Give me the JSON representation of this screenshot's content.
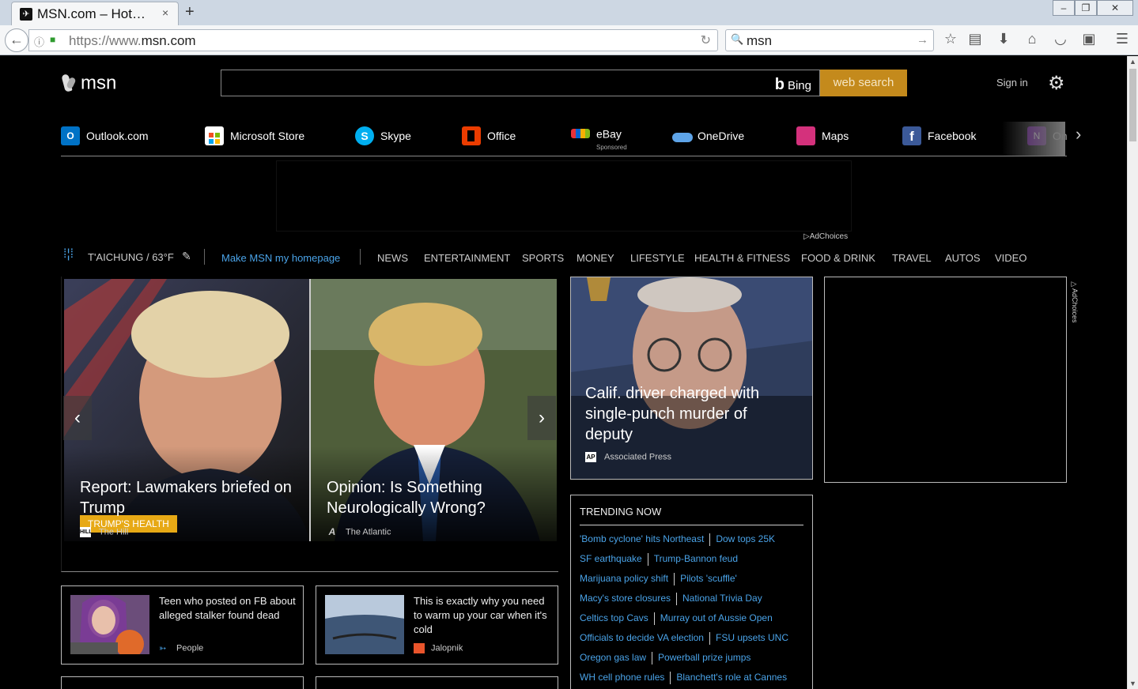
{
  "browser": {
    "tab_title": "MSN.com – Hot…",
    "tab_close": "×",
    "new_tab": "+",
    "url_prefix": "https://www.",
    "url_domain": "msn.com",
    "search_value": "msn",
    "window_controls": [
      "minimize",
      "restore",
      "close"
    ]
  },
  "header": {
    "logo_text": "msn",
    "search_placeholder": "",
    "bing_b": "b",
    "bing_label": "Bing",
    "websearch_label": "web search",
    "signin_label": "Sign in"
  },
  "quicklinks": [
    {
      "label": "Outlook.com",
      "icon": "outlook-icon",
      "color": "#0072c6"
    },
    {
      "label": "Microsoft Store",
      "icon": "store-icon",
      "color": "#ffffff"
    },
    {
      "label": "Skype",
      "icon": "skype-icon",
      "color": "#00aff0"
    },
    {
      "label": "Office",
      "icon": "office-icon",
      "color": "#eb3c00"
    },
    {
      "label": "eBay",
      "sub": "Sponsored",
      "icon": "ebay-icon",
      "color": "#e53238"
    },
    {
      "label": "OneDrive",
      "icon": "onedrive-icon",
      "color": "#5ea4e8"
    },
    {
      "label": "Maps",
      "icon": "maps-icon",
      "color": "#d4317c"
    },
    {
      "label": "Facebook",
      "icon": "facebook-icon",
      "color": "#3b5998"
    },
    {
      "label": "On",
      "icon": "onenote-icon",
      "color": "#7719aa"
    }
  ],
  "ad": {
    "adchoices": "AdChoices"
  },
  "nav": {
    "weather": "T'AICHUNG / 63°F",
    "homepage": "Make MSN my homepage",
    "links": [
      "NEWS",
      "ENTERTAINMENT",
      "SPORTS",
      "MONEY",
      "LIFESTYLE",
      "HEALTH & FITNESS",
      "FOOD & DRINK",
      "TRAVEL",
      "AUTOS",
      "VIDEO"
    ]
  },
  "hero": {
    "tag": "TRUMP'S HEALTH",
    "slides": [
      {
        "title": "Report: Lawmakers briefed on Trump",
        "source": "The Hill",
        "source_logo": "HILL"
      },
      {
        "title": "Opinion: Is Something Neurologically Wrong?",
        "source": "The Atlantic",
        "source_logo": "A"
      }
    ]
  },
  "story": {
    "title": "Calif. driver charged with single-punch murder of deputy",
    "source": "Associated Press",
    "source_logo": "AP"
  },
  "trending": {
    "heading": "TRENDING NOW",
    "rows": [
      [
        "'Bomb cyclone' hits Northeast",
        "Dow tops 25K"
      ],
      [
        "SF earthquake",
        "Trump-Bannon feud"
      ],
      [
        "Marijuana policy shift",
        "Pilots 'scuffle'"
      ],
      [
        "Macy's store closures",
        "National Trivia Day"
      ],
      [
        "Celtics top Cavs",
        "Murray out of Aussie Open"
      ],
      [
        "Officials to decide VA election",
        "FSU upsets UNC"
      ],
      [
        "Oregon gas law",
        "Powerball prize jumps"
      ],
      [
        "WH cell phone rules",
        "Blanchett's role at Cannes"
      ]
    ]
  },
  "cards": [
    {
      "title": "Teen who posted on FB about alleged stalker found dead",
      "source": "People"
    },
    {
      "title": "This is exactly why you need to warm up your car when it's cold",
      "source": "Jalopnik"
    }
  ]
}
